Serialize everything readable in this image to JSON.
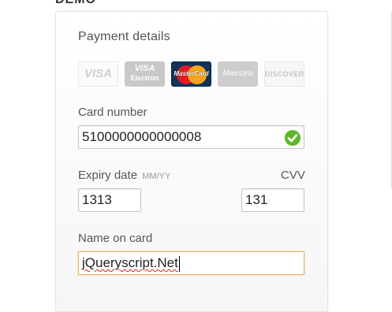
{
  "page": {
    "heading": "DEMO"
  },
  "payment": {
    "title": "Payment details",
    "card_logos": [
      {
        "name": "VISA"
      },
      {
        "name": "VISA",
        "sub": "Electron"
      },
      {
        "name": "MasterCard"
      },
      {
        "name": "Maestro"
      },
      {
        "name": "DISCOVER"
      }
    ],
    "card_number": {
      "label": "Card number",
      "value": "5100000000000008",
      "valid": true
    },
    "expiry": {
      "label": "Expiry date",
      "hint": "MM/YY",
      "value": "1313"
    },
    "cvv": {
      "label": "CVV",
      "value": "131"
    },
    "name_on_card": {
      "label": "Name on card",
      "value": "jQueryscript.Net"
    }
  },
  "colors": {
    "valid_check": "#5cb82a",
    "focus_border": "#e6b25d",
    "mastercard_bg": "#10335a"
  }
}
